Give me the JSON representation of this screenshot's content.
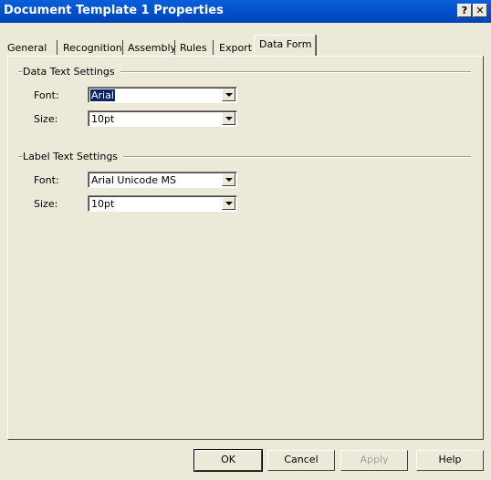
{
  "window": {
    "title": "Document Template 1 Properties",
    "help_button": "?",
    "close_button": "✕"
  },
  "tabs": [
    {
      "label": "General",
      "active": false
    },
    {
      "label": "Recognition",
      "active": false
    },
    {
      "label": "Assembly",
      "active": false
    },
    {
      "label": "Rules",
      "active": false
    },
    {
      "label": "Export",
      "active": false
    },
    {
      "label": "Data Form",
      "active": true
    }
  ],
  "data_text_settings": {
    "heading": "Data Text Settings",
    "font_label": "Font:",
    "font_value": "Arial",
    "size_label": "Size:",
    "size_value": "10pt"
  },
  "label_text_settings": {
    "heading": "Label Text Settings",
    "font_label": "Font:",
    "font_value": "Arial Unicode MS",
    "size_label": "Size:",
    "size_value": "10pt"
  },
  "buttons": {
    "ok": "OK",
    "cancel": "Cancel",
    "apply": "Apply",
    "help": "Help"
  },
  "colors": {
    "titlebar": "#0453d0",
    "dialog_bg": "#ece9d8",
    "selection": "#0a246a"
  }
}
